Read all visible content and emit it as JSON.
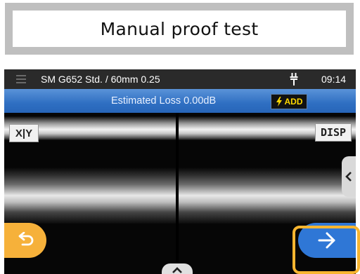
{
  "title": "Manual proof test",
  "status_bar": {
    "fiber_type": "SM G652 Std. / 60mm 0.25",
    "time": "09:14",
    "menu_icon": "hamburger-menu-icon",
    "power_icon": "plug-icon"
  },
  "loss_bar": {
    "text": "Estimated Loss  0.00dB",
    "add_label": "ADD",
    "add_icon": "lightning-icon"
  },
  "buttons": {
    "xy_label": "X|Y",
    "disp_label": "DISP",
    "back_icon": "return-arrow-icon",
    "next_icon": "right-arrow-icon",
    "side_tab_icon": "chevron-left-icon",
    "bottom_tab_icon": "chevron-up-icon"
  },
  "colors": {
    "loss_bar": "#2f6fc2",
    "add_text": "#ffd800",
    "back_button": "#f6b13a",
    "next_button": "#2f77d6",
    "highlight": "#f7b530"
  }
}
